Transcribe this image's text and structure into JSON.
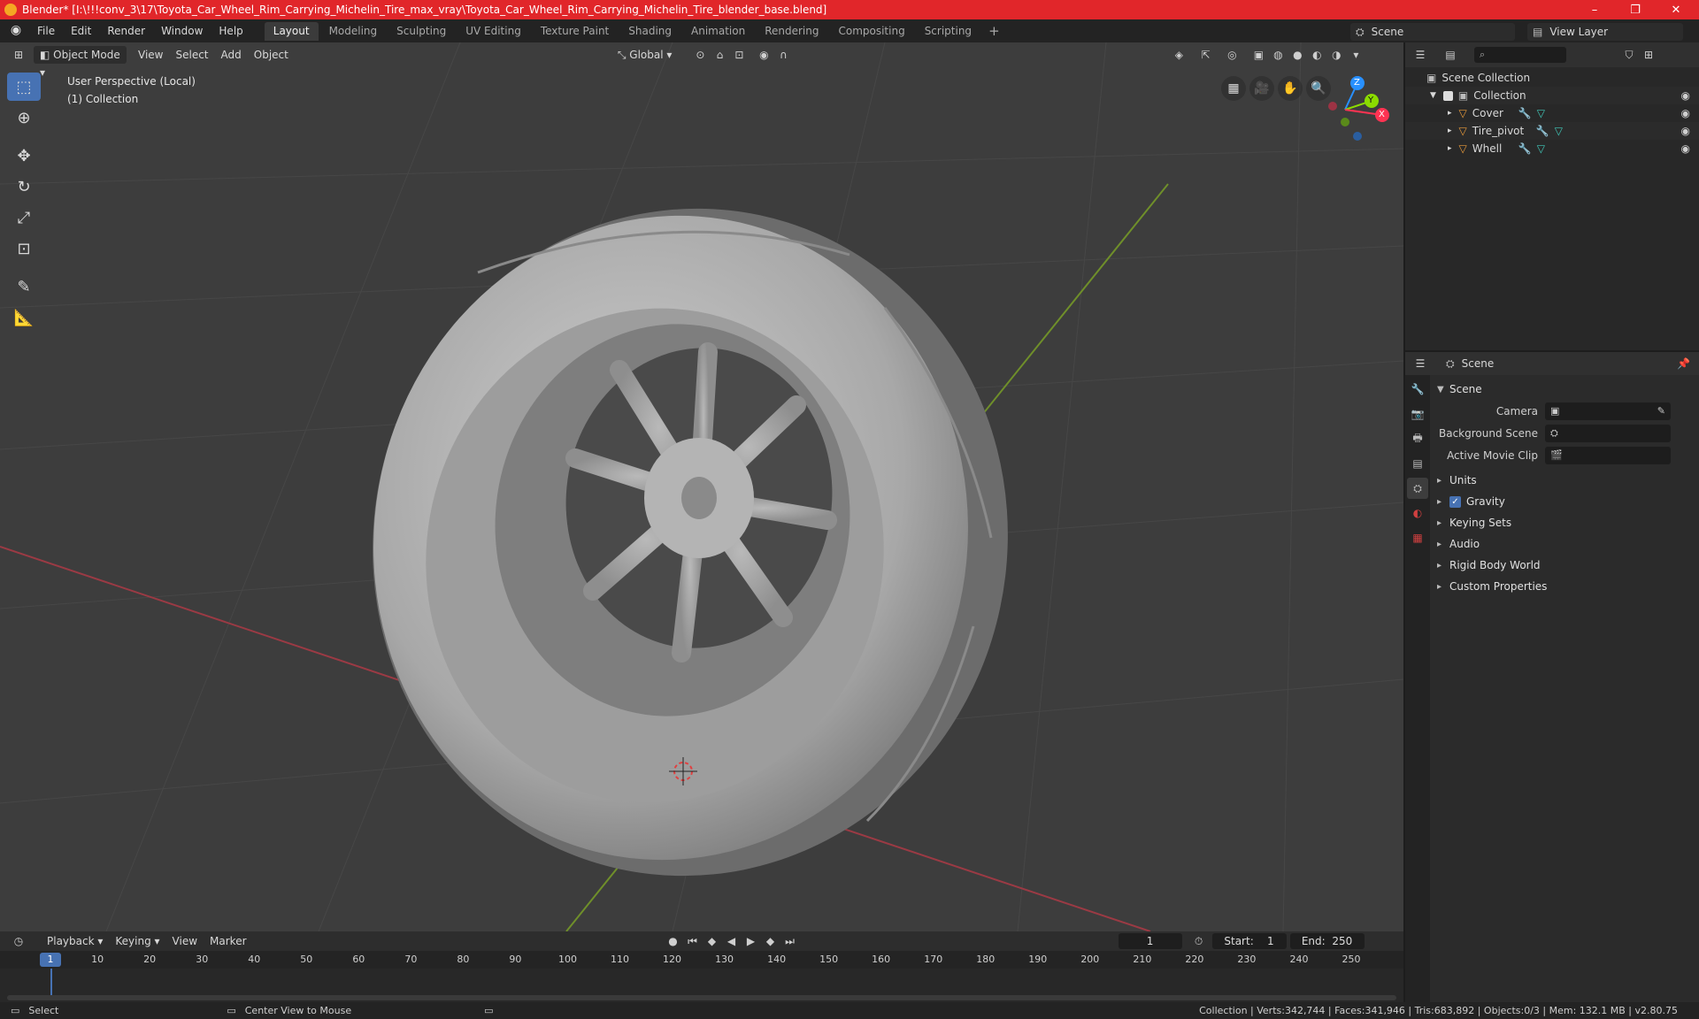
{
  "window": {
    "title": "Blender* [I:\\!!!conv_3\\17\\Toyota_Car_Wheel_Rim_Carrying_Michelin_Tire_max_vray\\Toyota_Car_Wheel_Rim_Carrying_Michelin_Tire_blender_base.blend]",
    "minimize": "–",
    "maximize": "❐",
    "close": "✕"
  },
  "menu": [
    "File",
    "Edit",
    "Render",
    "Window",
    "Help"
  ],
  "workspaces": [
    "Layout",
    "Modeling",
    "Sculpting",
    "UV Editing",
    "Texture Paint",
    "Shading",
    "Animation",
    "Rendering",
    "Compositing",
    "Scripting"
  ],
  "workspace_add": "+",
  "scene_name": "Scene",
  "view_layer": "View Layer",
  "viewport": {
    "mode": "Object Mode",
    "menus": [
      "View",
      "Select",
      "Add",
      "Object"
    ],
    "orientation": "Global",
    "perspective": "User Perspective (Local)",
    "collection": "(1) Collection",
    "gizmo": {
      "x": "X",
      "y": "Y",
      "z": "Z"
    }
  },
  "outliner": {
    "root": "Scene Collection",
    "collection": "Collection",
    "objects": [
      "Cover",
      "Tire_pivot",
      "Whell"
    ]
  },
  "properties": {
    "header": "Scene",
    "section": "Scene",
    "rows": [
      {
        "label": "Camera"
      },
      {
        "label": "Background Scene"
      },
      {
        "label": "Active Movie Clip"
      }
    ],
    "panels": [
      "Units",
      "Gravity",
      "Keying Sets",
      "Audio",
      "Rigid Body World",
      "Custom Properties"
    ]
  },
  "timeline": {
    "menus": [
      "Playback",
      "Keying",
      "View",
      "Marker"
    ],
    "current_frame": "1",
    "start_label": "Start:",
    "start": "1",
    "end_label": "End:",
    "end": "250",
    "ticks": [
      "10",
      "20",
      "30",
      "40",
      "50",
      "60",
      "70",
      "80",
      "90",
      "100",
      "110",
      "120",
      "130",
      "140",
      "150",
      "160",
      "170",
      "180",
      "190",
      "200",
      "210",
      "220",
      "230",
      "240",
      "250"
    ],
    "cursor": "1"
  },
  "status": {
    "left": "Select",
    "middle": "Center View to Mouse",
    "right": "Collection | Verts:342,744 | Faces:341,946 | Tris:683,892 | Objects:0/3 | Mem: 132.1 MB | v2.80.75"
  },
  "colors": {
    "accent": "#4772b3",
    "titlebar": "#e1262a",
    "axis_x": "#ff3352",
    "axis_y": "#8bdc00",
    "axis_z": "#2890ff"
  }
}
